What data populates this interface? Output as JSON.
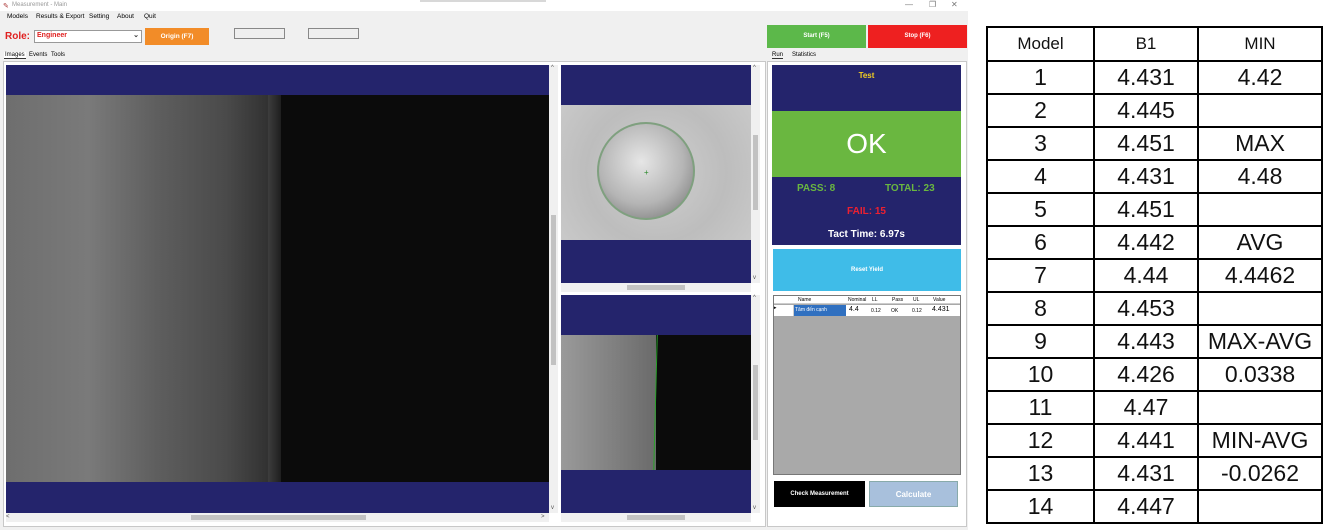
{
  "window": {
    "title": "Measurement - Main",
    "controls": {
      "minimize": "—",
      "maximize": "❐",
      "close": "✕"
    }
  },
  "menu": [
    "Models",
    "Results & Export",
    "Setting",
    "About",
    "Quit"
  ],
  "toolbar": {
    "role_label": "Role:",
    "role_value": "Engineer",
    "origin_label": "Origin (F7)"
  },
  "left_tabs": [
    "Images",
    "Events",
    "Tools"
  ],
  "right_tabs": [
    "Run",
    "Statistics"
  ],
  "controls": {
    "start_label": "Start (F5)",
    "stop_label": "Stop (F6)"
  },
  "status": {
    "test_label": "Test",
    "result": "OK",
    "pass": "PASS: 8",
    "total": "TOTAL: 23",
    "fail": "FAIL: 15",
    "tact": "Tact Time: 6.97s"
  },
  "reset_label": "Reset Yield",
  "grid": {
    "headers": [
      "Name",
      "Nominal",
      "LL",
      "Pass",
      "UL",
      "Value"
    ],
    "row": {
      "marker": "▸",
      "name": "Tâm đến cạnh",
      "nominal": "4.4",
      "ll": "0.12",
      "pass": "OK",
      "ul": "0.12",
      "value": "4.431"
    }
  },
  "bottom_buttons": {
    "check_label": "Check Measurement",
    "calc_label": "Calculate"
  },
  "table": {
    "headers": [
      "Model",
      "B1",
      "MIN"
    ],
    "rows": [
      [
        "1",
        "4.431",
        "4.42"
      ],
      [
        "2",
        "4.445",
        ""
      ],
      [
        "3",
        "4.451",
        "MAX"
      ],
      [
        "4",
        "4.431",
        "4.48"
      ],
      [
        "5",
        "4.451",
        ""
      ],
      [
        "6",
        "4.442",
        "AVG"
      ],
      [
        "7",
        "4.44",
        "4.4462"
      ],
      [
        "8",
        "4.453",
        ""
      ],
      [
        "9",
        "4.443",
        "MAX-AVG"
      ],
      [
        "10",
        "4.426",
        "0.0338"
      ],
      [
        "11",
        "4.47",
        ""
      ],
      [
        "12",
        "4.441",
        "MIN-AVG"
      ],
      [
        "13",
        "4.431",
        "-0.0262"
      ],
      [
        "14",
        "4.447",
        ""
      ]
    ]
  },
  "colors": {
    "navy": "#24246c",
    "ok_green": "#6ab740",
    "start_green": "#5cb84a",
    "stop_red": "#ee2020",
    "origin_orange": "#f28c28",
    "reset_blue": "#3fbce8",
    "tact_yellow": "#f5d020"
  }
}
